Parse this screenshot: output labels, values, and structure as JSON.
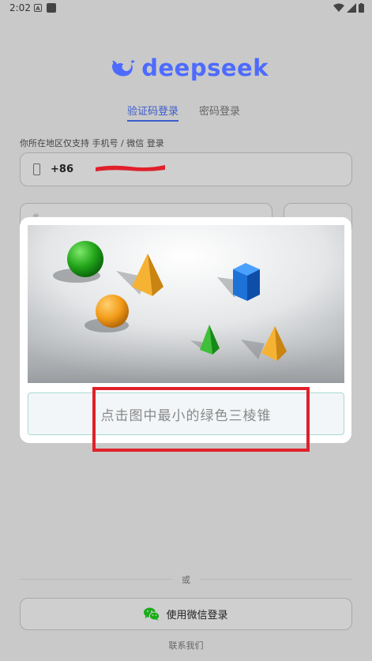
{
  "status_bar": {
    "time": "2:02",
    "notif_icon": "A"
  },
  "brand": {
    "name": "deepseek",
    "color": "#4d6bfe"
  },
  "tabs": [
    {
      "label": "验证码登录",
      "active": true
    },
    {
      "label": "密码登录",
      "active": false
    }
  ],
  "region_hint": "你所在地区仅支持 手机号 / 微信 登录",
  "phone": {
    "country_code": "+86"
  },
  "captcha": {
    "instruction": "点击图中最小的绿色三棱锥"
  },
  "divider_text": "或",
  "wechat_button": {
    "label": "使用微信登录",
    "icon": "wechat-icon",
    "icon_color": "#1aad19"
  },
  "contact_link": "联系我们",
  "colors": {
    "accent": "#3b5ccc",
    "highlight": "#e0202a"
  }
}
